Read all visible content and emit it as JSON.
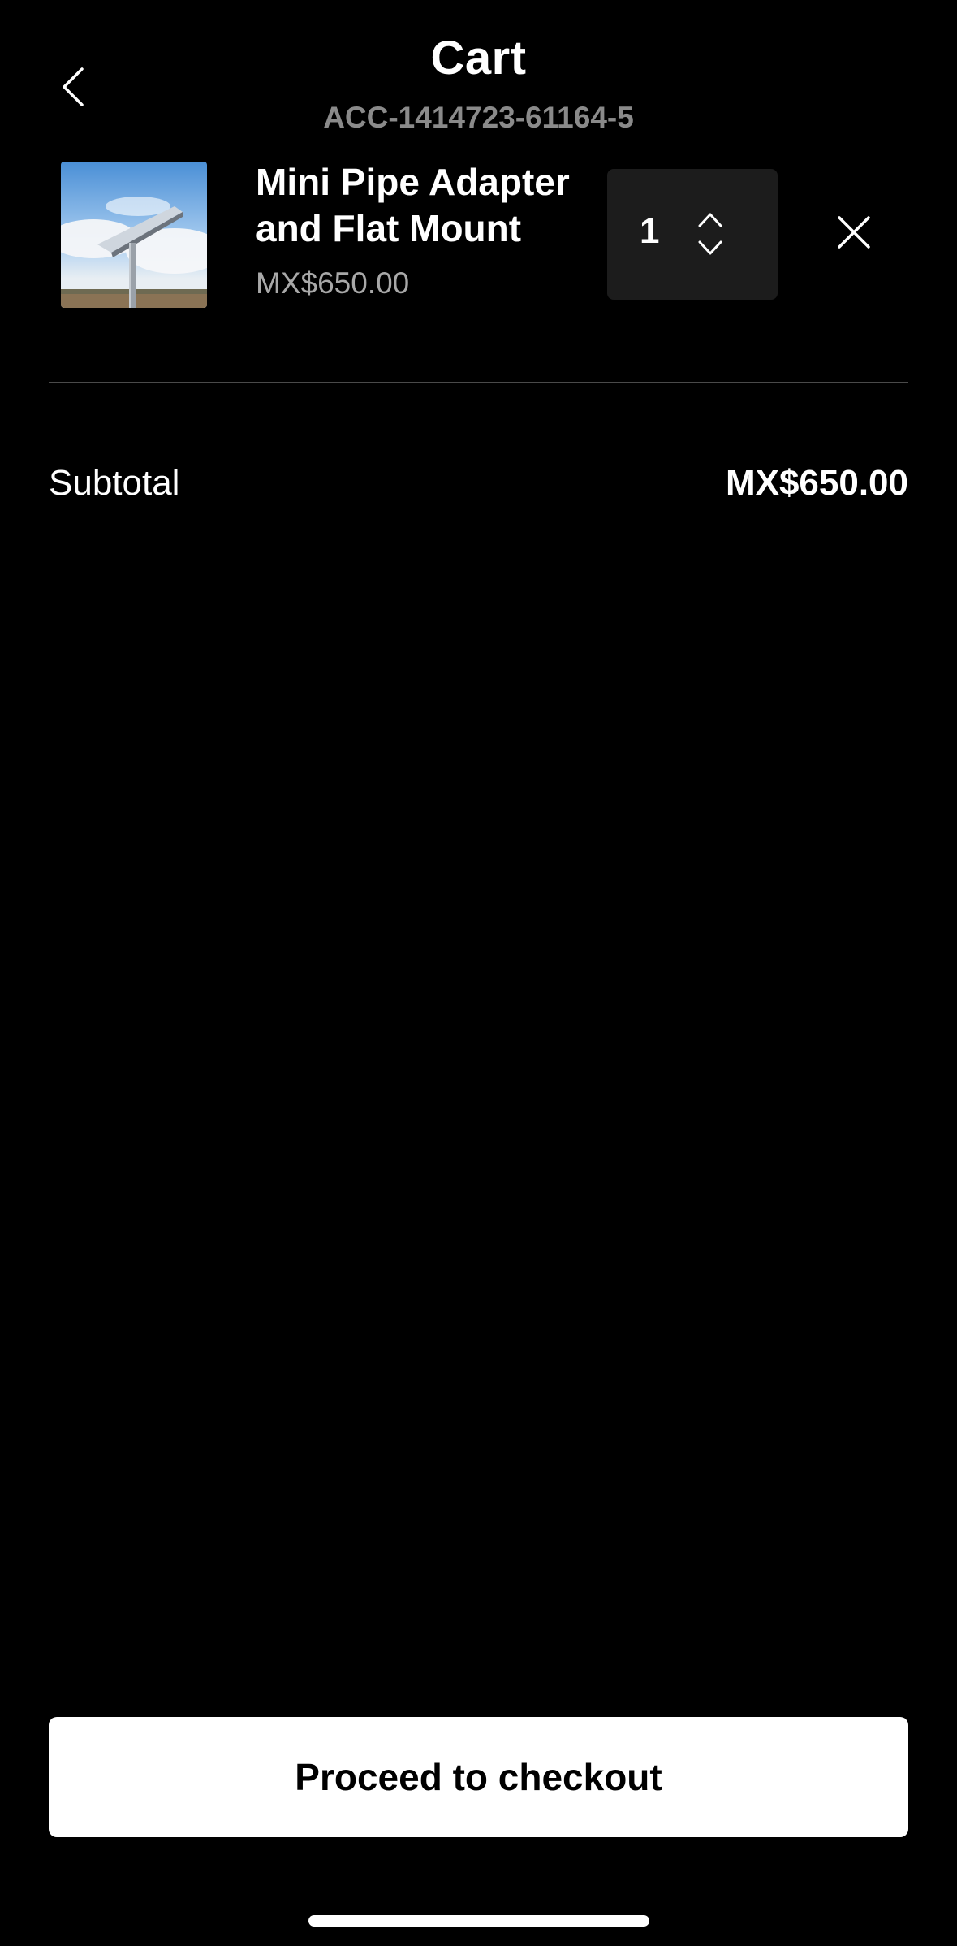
{
  "header": {
    "title": "Cart",
    "order_id": "ACC-1414723-61164-5",
    "back_icon": "chevron-left-icon"
  },
  "cart": {
    "items": [
      {
        "name": "Mini Pipe Adapter and Flat Mount",
        "price": "MX$650.00",
        "quantity": "1",
        "image": "product-thumbnail-pipe-mount"
      }
    ]
  },
  "summary": {
    "subtotal_label": "Subtotal",
    "subtotal_value": "MX$650.00"
  },
  "footer": {
    "checkout_label": "Proceed to checkout"
  },
  "colors": {
    "background": "#000000",
    "text_primary": "#ffffff",
    "text_secondary": "#8a8a8a",
    "stepper_bg": "#1c1c1c",
    "button_bg": "#ffffff",
    "button_text": "#000000"
  }
}
